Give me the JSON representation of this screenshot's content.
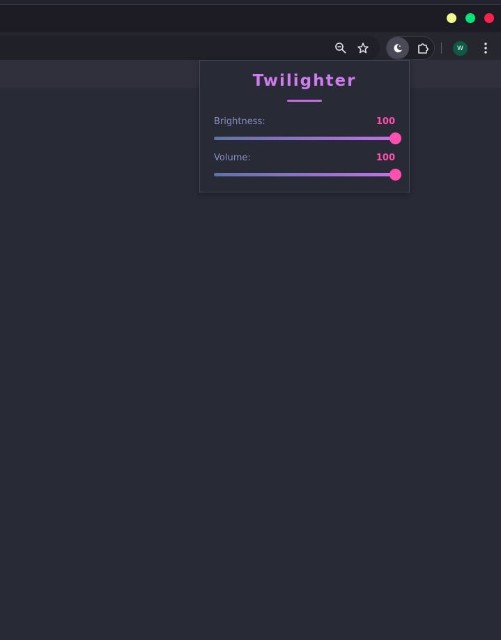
{
  "browser": {
    "window_controls": {
      "colors": {
        "minimize": "#f1fa8c",
        "maximize": "#00e676",
        "close": "#ff1f4b"
      }
    },
    "toolbar": {
      "icons": [
        "zoom-out-icon",
        "bookmark-star-icon",
        "moon-icon",
        "puzzle-icon",
        "kebab-menu-icon"
      ],
      "avatar_initial": "W",
      "avatar_color": "#0d5a45"
    }
  },
  "popup": {
    "title": "Twilighter",
    "accent_title_color": "#d07bf0",
    "value_color": "#ff4fb1",
    "sliders": [
      {
        "label": "Brightness:",
        "value": "100",
        "percent": 100
      },
      {
        "label": "Volume:",
        "value": "100",
        "percent": 100
      }
    ]
  }
}
